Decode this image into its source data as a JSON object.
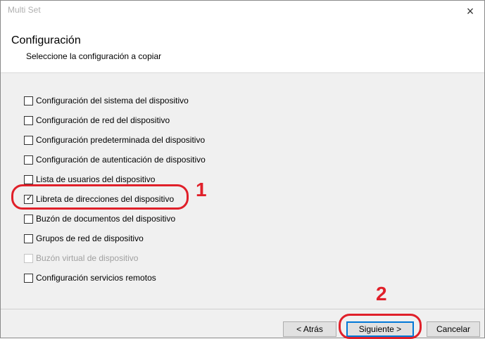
{
  "window": {
    "title": "Multi Set",
    "close_glyph": "×"
  },
  "header": {
    "title": "Configuración",
    "subtitle": "Seleccione la configuración a copiar"
  },
  "options": [
    {
      "label": "Configuración del sistema del dispositivo",
      "checked": false,
      "enabled": true
    },
    {
      "label": "Configuración de red del dispositivo",
      "checked": false,
      "enabled": true
    },
    {
      "label": "Configuración predeterminada del dispositivo",
      "checked": false,
      "enabled": true
    },
    {
      "label": "Configuración de autenticación de dispositivo",
      "checked": false,
      "enabled": true
    },
    {
      "label": "Lista de usuarios del dispositivo",
      "checked": false,
      "enabled": true
    },
    {
      "label": "Libreta de direcciones del dispositivo",
      "checked": true,
      "enabled": true
    },
    {
      "label": "Buzón de documentos del dispositivo",
      "checked": false,
      "enabled": true
    },
    {
      "label": "Grupos de red de dispositivo",
      "checked": false,
      "enabled": true
    },
    {
      "label": "Buzón virtual de dispositivo",
      "checked": false,
      "enabled": false
    },
    {
      "label": "Configuración servicios remotos",
      "checked": false,
      "enabled": true
    }
  ],
  "buttons": {
    "back": "< Atrás",
    "next": "Siguiente >",
    "cancel": "Cancelar"
  },
  "annotations": {
    "step1": "1",
    "step2": "2",
    "color": "#e0202a"
  },
  "check_glyph": "✓"
}
